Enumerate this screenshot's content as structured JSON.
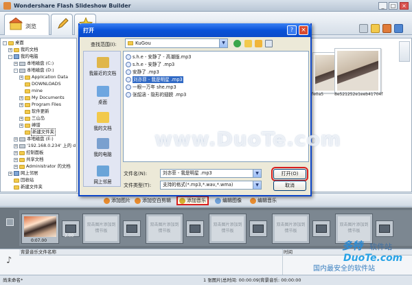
{
  "app": {
    "title": "Wondershare  Flash  Slideshow  Builder",
    "tab_browse": "浏览"
  },
  "tree": [
    {
      "label": "桌面",
      "level": 0,
      "icon": "folder",
      "exp": "-"
    },
    {
      "label": "我的文档",
      "level": 1,
      "icon": "folder",
      "exp": "+"
    },
    {
      "label": "我的电脑",
      "level": 1,
      "icon": "computer",
      "exp": "-"
    },
    {
      "label": "本地磁盘 (C:)",
      "level": 2,
      "icon": "drive",
      "exp": "+"
    },
    {
      "label": "本地磁盘 (D:)",
      "level": 2,
      "icon": "drive",
      "exp": "-"
    },
    {
      "label": "Application Data",
      "level": 3,
      "icon": "folder",
      "exp": "+"
    },
    {
      "label": "DOWNLOADS",
      "level": 3,
      "icon": "folder",
      "exp": ""
    },
    {
      "label": "mine",
      "level": 3,
      "icon": "folder",
      "exp": ""
    },
    {
      "label": "My Documents",
      "level": 3,
      "icon": "folder",
      "exp": "+"
    },
    {
      "label": "Program Files",
      "level": 3,
      "icon": "folder",
      "exp": "+"
    },
    {
      "label": "软件更新",
      "level": 3,
      "icon": "folder",
      "exp": ""
    },
    {
      "label": "三山岛",
      "level": 3,
      "icon": "folder",
      "exp": "+"
    },
    {
      "label": "嶂谱",
      "level": 3,
      "icon": "folder",
      "exp": "+"
    },
    {
      "label": "新建文件夹",
      "level": 3,
      "icon": "folder",
      "exp": "",
      "selected": true
    },
    {
      "label": "本地磁盘 (E:)",
      "level": 2,
      "icon": "drive",
      "exp": "+"
    },
    {
      "label": "'192.168.0.234' 上的 d (Z",
      "level": 2,
      "icon": "drive",
      "exp": "+"
    },
    {
      "label": "控制面板",
      "level": 2,
      "icon": "folder",
      "exp": "+"
    },
    {
      "label": "共享文档",
      "level": 2,
      "icon": "folder",
      "exp": "+"
    },
    {
      "label": "Administrator 的文档",
      "level": 2,
      "icon": "folder",
      "exp": "+"
    },
    {
      "label": "网上邻居",
      "level": 1,
      "icon": "computer",
      "exp": "+"
    },
    {
      "label": "回收站",
      "level": 1,
      "icon": "folder",
      "exp": ""
    },
    {
      "label": "新建文件夹",
      "level": 1,
      "icon": "folder",
      "exp": ""
    }
  ],
  "thumbs": [
    {
      "caption": "fe0a5"
    },
    {
      "caption": "8e521252e1eeb41704f"
    }
  ],
  "actions": {
    "add_image": "添加图片",
    "add_blank": "添加空白剪辑",
    "add_music": "添加音乐",
    "edit_image": "编辑图像",
    "edit_music": "编辑音乐"
  },
  "storyboard": {
    "first_time": "0:07.00",
    "first_duration": "2.00",
    "placeholder": "双击图片添加到情节板"
  },
  "music": {
    "col_name": "背景音乐文件名称",
    "col_time": "时间"
  },
  "status": {
    "left": "尚未命名*",
    "right": "1 张图片|总时间: 00:00:09|背景音乐: 00:00:00"
  },
  "watermark": "www.DuoTe.com",
  "logo": {
    "top": "多特",
    "top_sub": "软件站",
    "mid": "DuoTe.com",
    "bottom": "国内最安全的软件站"
  },
  "dialog": {
    "title": "打开",
    "help_btn": "?",
    "close_btn": "×",
    "lookin_label": "查找范围(I):",
    "lookin_value": "KuGou",
    "places": [
      "我最近的文档",
      "桌面",
      "我的文档",
      "我的电脑",
      "网上邻居"
    ],
    "files": [
      "s.h.e - 安静了 - 高潮版.mp3",
      "s.h.e - 安静了 .mp3",
      "安静了 .mp3",
      "刘亦菲 - 我是明星 .mp3",
      "一眼一万年 she.mp3",
      "张韶涵 - 隐形的翅膀 .mp3"
    ],
    "selected_index": 3,
    "filename_label": "文件名(N):",
    "filename_value": "刘亦菲 - 我是明星 .mp3",
    "filetype_label": "文件类型(T):",
    "filetype_value": "支持的格式(*.mp3,*.wav,*.wma)",
    "open_btn": "打开(O)",
    "cancel_btn": "取消"
  }
}
